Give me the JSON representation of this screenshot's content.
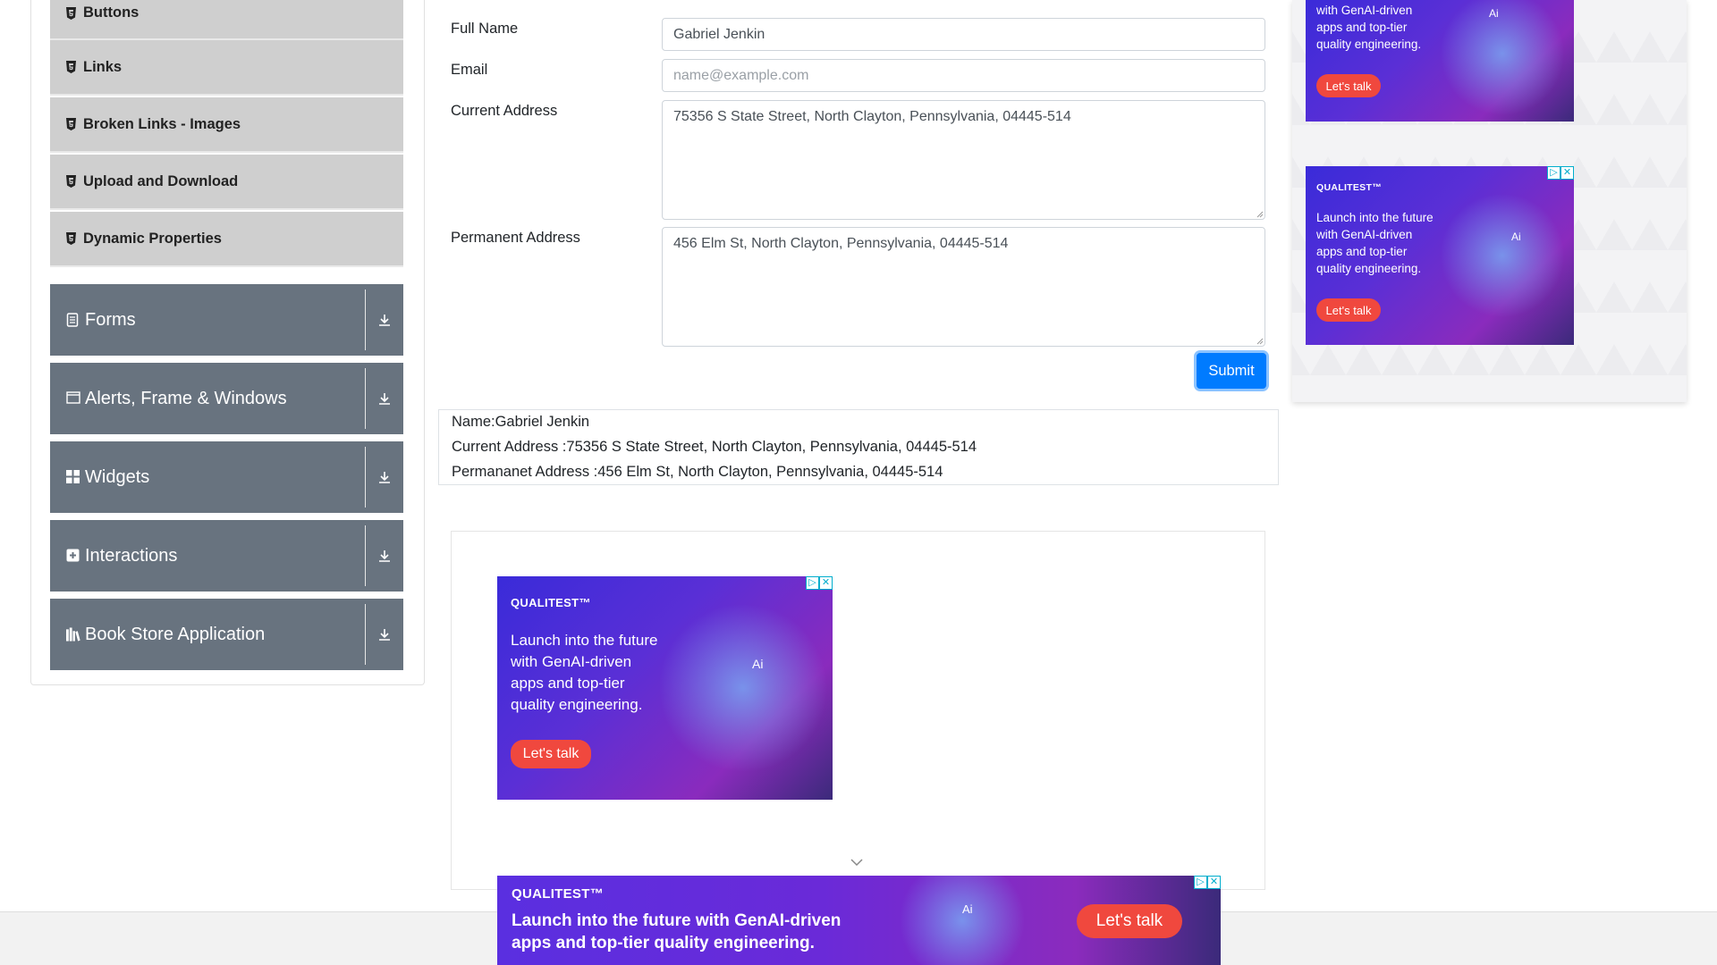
{
  "sidebar": {
    "sub_items": [
      {
        "label": "Buttons"
      },
      {
        "label": "Links"
      },
      {
        "label": "Broken Links - Images"
      },
      {
        "label": "Upload and Download"
      },
      {
        "label": "Dynamic Properties"
      }
    ],
    "groups": [
      {
        "label": "Forms",
        "icon": "document-icon"
      },
      {
        "label": "Alerts, Frame & Windows",
        "icon": "window-icon"
      },
      {
        "label": "Widgets",
        "icon": "widgets-icon"
      },
      {
        "label": "Interactions",
        "icon": "interactions-icon"
      },
      {
        "label": "Book Store Application",
        "icon": "books-icon"
      }
    ]
  },
  "form": {
    "full_name_label": "Full Name",
    "full_name_value": "Gabriel Jenkin",
    "email_label": "Email",
    "email_placeholder": "name@example.com",
    "current_address_label": "Current Address",
    "current_address_value": "75356 S State Street, North Clayton, Pennsylvania, 04445-514",
    "permanent_address_label": "Permanent Address",
    "permanent_address_value": "456 Elm St, North Clayton, Pennsylvania, 04445-514",
    "submit_label": "Submit"
  },
  "output": {
    "name": "Name:Gabriel Jenkin",
    "current_address": "Current Address :75356 S State Street, North Clayton, Pennsylvania, 04445-514",
    "permanent_address": "Permananet Address :456 Elm St, North Clayton, Pennsylvania, 04445-514"
  },
  "ads": {
    "brand": "QUALITEST™",
    "copy_lines": [
      "Launch into the future",
      "with GenAI-driven",
      "apps and top-tier",
      "quality engineering."
    ],
    "copy_lines_top_cut": [
      "with GenAI-driven",
      "apps and top-tier",
      "quality engineering."
    ],
    "banner_lines": [
      "Launch into the future with GenAI-driven",
      "apps and top-tier quality engineering."
    ],
    "cta": "Let's talk",
    "badge_info": "▷",
    "badge_close": "✕",
    "robot_text": "Ai",
    "colors": {
      "cta": "#f0483e",
      "accent": "#007bff"
    }
  }
}
